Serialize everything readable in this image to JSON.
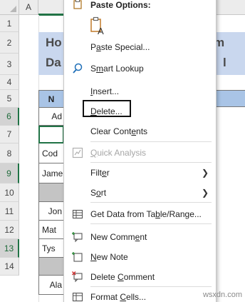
{
  "columns": {
    "a": "A"
  },
  "rows": [
    "1",
    "2",
    "3",
    "4",
    "5",
    "6",
    "7",
    "8",
    "9",
    "10",
    "11",
    "12",
    "13",
    "14"
  ],
  "title": {
    "left_top": "Ho",
    "left_bottom": "Da",
    "right_top": "m",
    "right_bottom": "l"
  },
  "table": {
    "header": "N",
    "cells": [
      "Ad",
      "",
      "Cod",
      "Jame",
      "",
      "Jon",
      "Mat",
      "Tys",
      "",
      "Ala"
    ]
  },
  "menu": {
    "paste_options": "Paste Options:",
    "paste_special": "Paste Special...",
    "smart_lookup": "Smart Lookup",
    "insert": "Insert...",
    "delete": "Delete...",
    "clear_contents": "Clear Contents",
    "quick_analysis": "Quick Analysis",
    "filter": "Filter",
    "sort": "Sort",
    "get_data": "Get Data from Table/Range...",
    "new_comment": "New Comment",
    "new_note": "New Note",
    "delete_comment": "Delete Comment",
    "format_cells": "Format Cells..."
  },
  "icons": {
    "paste": "clipboard-icon",
    "smart_lookup": "search-icon",
    "quick_analysis": "quick-analysis-icon",
    "get_data": "table-icon",
    "new_comment": "comment-icon",
    "new_note": "note-icon",
    "delete_comment": "delete-comment-icon",
    "format_cells": "format-cells-icon"
  },
  "colors": {
    "accent": "#217346",
    "title_band": "#c9d7ee",
    "table_header": "#a9c4e6"
  },
  "watermark": "wsxdn.com"
}
